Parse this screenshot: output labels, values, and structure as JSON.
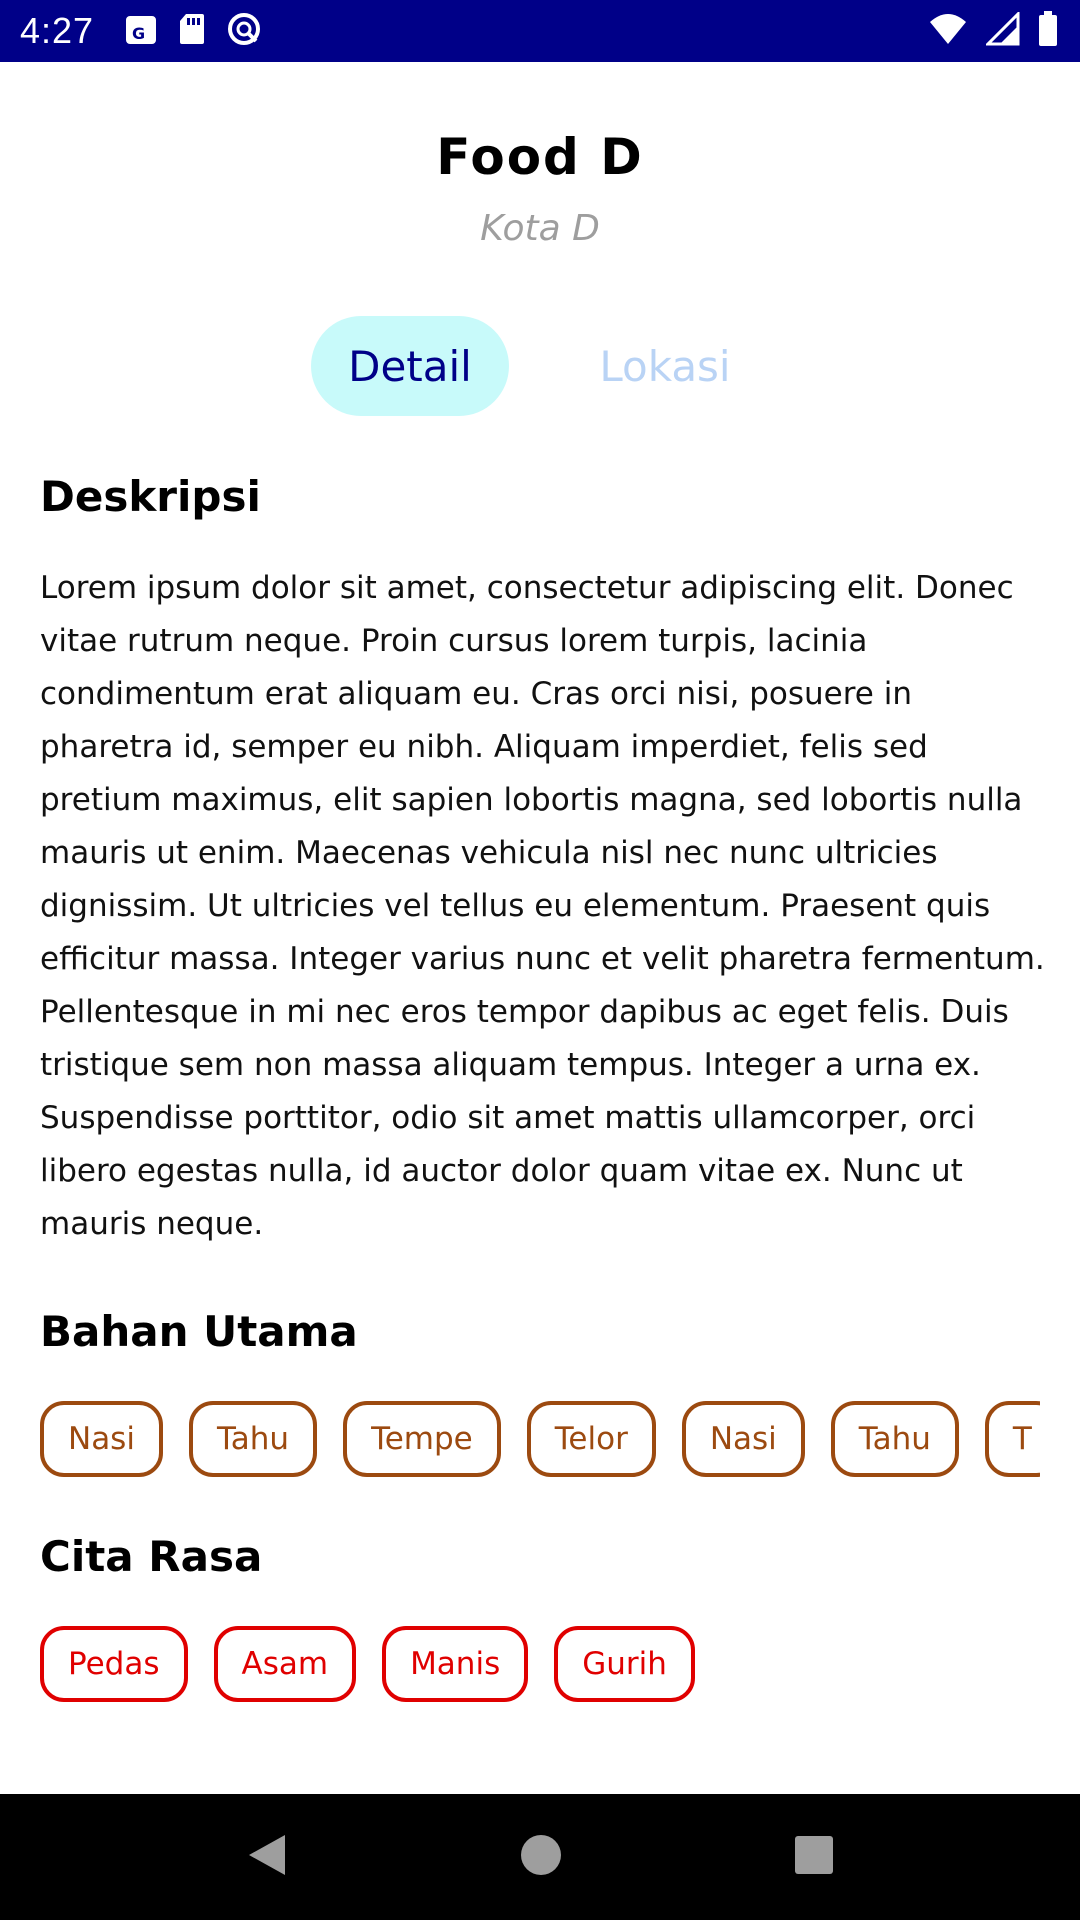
{
  "status_bar": {
    "time": "4:27",
    "left_icons": [
      "maps-icon",
      "sd-card-icon",
      "data-saver-icon"
    ],
    "right_icons": [
      "wifi-icon",
      "cell-signal-icon",
      "battery-icon"
    ]
  },
  "header": {
    "title": "Food D",
    "subtitle": "Kota D"
  },
  "tabs": [
    {
      "label": "Detail",
      "selected": true
    },
    {
      "label": "Lokasi",
      "selected": false
    }
  ],
  "description": {
    "heading": "Deskripsi",
    "text": "Lorem ipsum dolor sit amet, consectetur adipiscing elit. Donec vitae rutrum neque. Proin cursus lorem turpis, lacinia condimentum erat aliquam eu. Cras orci nisi, posuere in pharetra id, semper eu nibh. Aliquam imperdiet, felis sed pretium maximus, elit sapien lobortis magna, sed lobortis nulla mauris ut enim. Maecenas vehicula nisl nec nunc ultricies dignissim. Ut ultricies vel tellus eu elementum. Praesent quis efficitur massa. Integer varius nunc et velit pharetra fermentum. Pellentesque in mi nec eros tempor dapibus ac eget felis. Duis tristique sem non massa aliquam tempus. Integer a urna ex. Suspendisse porttitor, odio sit amet mattis ullamcorper, orci libero egestas nulla, id auctor dolor quam vitae ex. Nunc ut mauris neque."
  },
  "main_ingredients": {
    "heading": "Bahan Utama",
    "items": [
      "Nasi",
      "Tahu",
      "Tempe",
      "Telor",
      "Nasi",
      "Tahu",
      "T"
    ]
  },
  "taste": {
    "heading": "Cita Rasa",
    "items": [
      "Pedas",
      "Asam",
      "Manis",
      "Gurih"
    ]
  },
  "colors": {
    "status_bar": "#000088",
    "tab_selected_bg": "#c8fafa",
    "tab_selected_text": "#000088",
    "tab_unselected_text": "#b9d3f5",
    "ingredient_chip": "#9c4a10",
    "taste_chip": "#e00000"
  },
  "nav_bar": {
    "buttons": [
      "back-icon",
      "home-icon",
      "recents-icon"
    ]
  }
}
